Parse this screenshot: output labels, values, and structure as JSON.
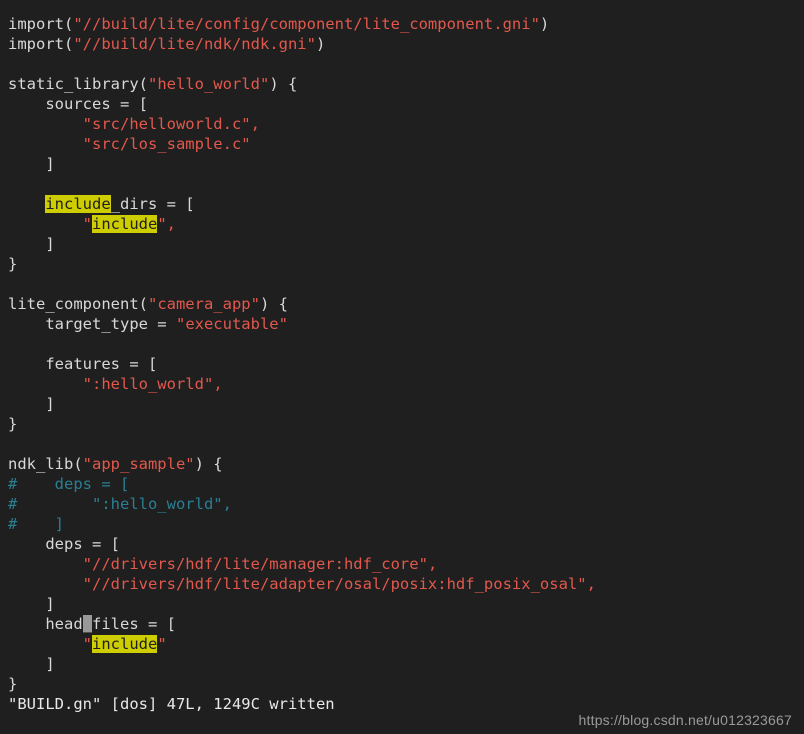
{
  "editor": {
    "app": "vim",
    "filename": "BUILD.gn",
    "background_color": "#1f1f1f",
    "foreground_color": "#d8d8d8",
    "string_color": "#e2584d",
    "comment_color": "#2a7f92",
    "search_highlight_color": "#cdcd00",
    "cursor_color": "#999999"
  },
  "lines": [
    {
      "n": 1,
      "segments": [
        {
          "text": "import(",
          "type": "plain"
        },
        {
          "text": "\"//build/lite/config/component/lite_component.gni\"",
          "type": "str"
        },
        {
          "text": ")",
          "type": "plain"
        }
      ]
    },
    {
      "n": 2,
      "segments": [
        {
          "text": "import(",
          "type": "plain"
        },
        {
          "text": "\"//build/lite/ndk/ndk.gni\"",
          "type": "str"
        },
        {
          "text": ")",
          "type": "plain"
        }
      ]
    },
    {
      "n": 3,
      "segments": []
    },
    {
      "n": 4,
      "segments": [
        {
          "text": "static_library(",
          "type": "plain"
        },
        {
          "text": "\"hello_world\"",
          "type": "str"
        },
        {
          "text": ") {",
          "type": "plain"
        }
      ]
    },
    {
      "n": 5,
      "segments": [
        {
          "text": "    sources = [",
          "type": "plain"
        }
      ]
    },
    {
      "n": 6,
      "segments": [
        {
          "text": "        ",
          "type": "plain"
        },
        {
          "text": "\"src/helloworld.c\"",
          "type": "str"
        },
        {
          "text": ",",
          "type": "str"
        }
      ]
    },
    {
      "n": 7,
      "segments": [
        {
          "text": "        ",
          "type": "plain"
        },
        {
          "text": "\"src/los_sample.c\"",
          "type": "str"
        }
      ]
    },
    {
      "n": 8,
      "segments": [
        {
          "text": "    ]",
          "type": "plain"
        }
      ]
    },
    {
      "n": 9,
      "segments": []
    },
    {
      "n": 10,
      "segments": [
        {
          "text": "    ",
          "type": "plain"
        },
        {
          "text": "include",
          "type": "hl"
        },
        {
          "text": "_dirs = [",
          "type": "plain"
        }
      ]
    },
    {
      "n": 11,
      "segments": [
        {
          "text": "        ",
          "type": "plain"
        },
        {
          "text": "\"",
          "type": "str"
        },
        {
          "text": "include",
          "type": "hl"
        },
        {
          "text": "\",",
          "type": "str"
        }
      ]
    },
    {
      "n": 12,
      "segments": [
        {
          "text": "    ]",
          "type": "plain"
        }
      ]
    },
    {
      "n": 13,
      "segments": [
        {
          "text": "}",
          "type": "plain"
        }
      ]
    },
    {
      "n": 14,
      "segments": []
    },
    {
      "n": 15,
      "segments": [
        {
          "text": "lite_component(",
          "type": "plain"
        },
        {
          "text": "\"camera_app\"",
          "type": "str"
        },
        {
          "text": ") {",
          "type": "plain"
        }
      ]
    },
    {
      "n": 16,
      "segments": [
        {
          "text": "    target_type = ",
          "type": "plain"
        },
        {
          "text": "\"executable\"",
          "type": "str"
        }
      ]
    },
    {
      "n": 17,
      "segments": []
    },
    {
      "n": 18,
      "segments": [
        {
          "text": "    features = [",
          "type": "plain"
        }
      ]
    },
    {
      "n": 19,
      "segments": [
        {
          "text": "        ",
          "type": "plain"
        },
        {
          "text": "\":hello_world\"",
          "type": "str"
        },
        {
          "text": ",",
          "type": "str"
        }
      ]
    },
    {
      "n": 20,
      "segments": [
        {
          "text": "    ]",
          "type": "plain"
        }
      ]
    },
    {
      "n": 21,
      "segments": [
        {
          "text": "}",
          "type": "plain"
        }
      ]
    },
    {
      "n": 22,
      "segments": []
    },
    {
      "n": 23,
      "segments": [
        {
          "text": "ndk_lib(",
          "type": "plain"
        },
        {
          "text": "\"app_sample\"",
          "type": "str"
        },
        {
          "text": ") {",
          "type": "plain"
        }
      ]
    },
    {
      "n": 24,
      "segments": [
        {
          "text": "#    deps = [",
          "type": "comment"
        }
      ]
    },
    {
      "n": 25,
      "segments": [
        {
          "text": "#        \":hello_world\",",
          "type": "comment"
        }
      ]
    },
    {
      "n": 26,
      "segments": [
        {
          "text": "#    ]",
          "type": "comment"
        }
      ]
    },
    {
      "n": 27,
      "segments": [
        {
          "text": "    deps = [",
          "type": "plain"
        }
      ]
    },
    {
      "n": 28,
      "segments": [
        {
          "text": "        ",
          "type": "plain"
        },
        {
          "text": "\"//drivers/hdf/lite/manager:hdf_core\"",
          "type": "str"
        },
        {
          "text": ",",
          "type": "str"
        }
      ]
    },
    {
      "n": 29,
      "segments": [
        {
          "text": "        ",
          "type": "plain"
        },
        {
          "text": "\"//drivers/hdf/lite/adapter/osal/posix:hdf_posix_osal\"",
          "type": "str"
        },
        {
          "text": ",",
          "type": "str"
        }
      ]
    },
    {
      "n": 30,
      "segments": [
        {
          "text": "    ]",
          "type": "plain"
        }
      ]
    },
    {
      "n": 31,
      "segments": [
        {
          "text": "    head",
          "type": "plain"
        },
        {
          "text": "_",
          "type": "cursor"
        },
        {
          "text": "files = [",
          "type": "plain"
        }
      ]
    },
    {
      "n": 32,
      "segments": [
        {
          "text": "        ",
          "type": "plain"
        },
        {
          "text": "\"",
          "type": "str"
        },
        {
          "text": "include",
          "type": "hl"
        },
        {
          "text": "\"",
          "type": "str"
        }
      ]
    },
    {
      "n": 33,
      "segments": [
        {
          "text": "    ]",
          "type": "plain"
        }
      ]
    },
    {
      "n": 34,
      "segments": [
        {
          "text": "}",
          "type": "plain"
        }
      ]
    }
  ],
  "status": {
    "message": "\"BUILD.gn\" [dos] 47L, 1249C written"
  },
  "watermark": {
    "text": "https://blog.csdn.net/u012323667"
  }
}
